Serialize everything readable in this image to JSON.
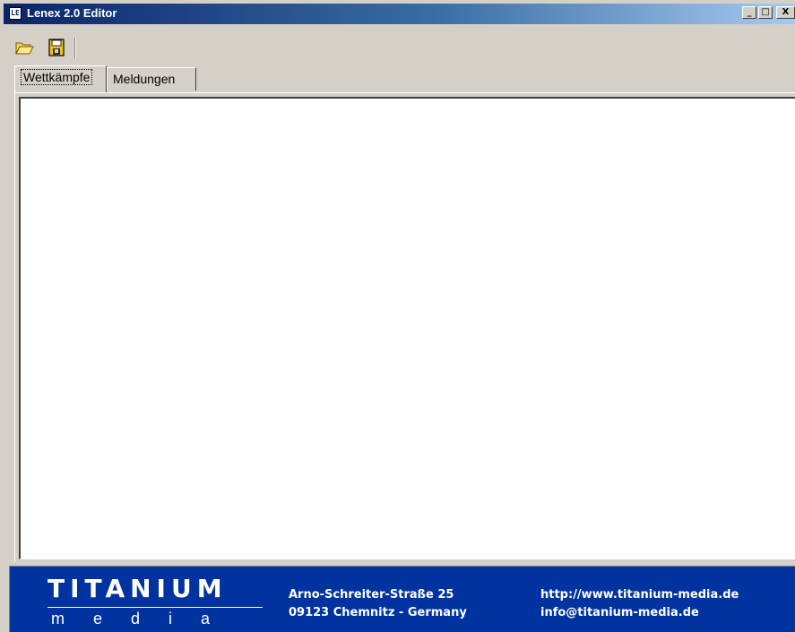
{
  "window": {
    "title": "Lenex 2.0 Editor",
    "icon_label": "LE",
    "buttons": {
      "minimize": "_",
      "maximize": "□",
      "close": "X"
    }
  },
  "toolbar": {
    "items": [
      {
        "name": "open",
        "icon": "folder-open-icon"
      },
      {
        "name": "save",
        "icon": "floppy-disk-icon"
      }
    ]
  },
  "tabs": [
    {
      "label": "Wettkämpfe",
      "active": true
    },
    {
      "label": "Meldungen",
      "active": false
    }
  ],
  "footer": {
    "logo_top": "TITANIUM",
    "logo_bottom": "media",
    "address_line1": "Arno-Schreiter-Straße 25",
    "address_line2": "09123 Chemnitz - Germany",
    "website": "http://www.titanium-media.de",
    "email": "info@titanium-media.de",
    "banner_color": "#0033a0"
  },
  "colors": {
    "titlebar_start": "#0a246a",
    "titlebar_end": "#a6caf0",
    "chrome": "#d4d0c8"
  }
}
